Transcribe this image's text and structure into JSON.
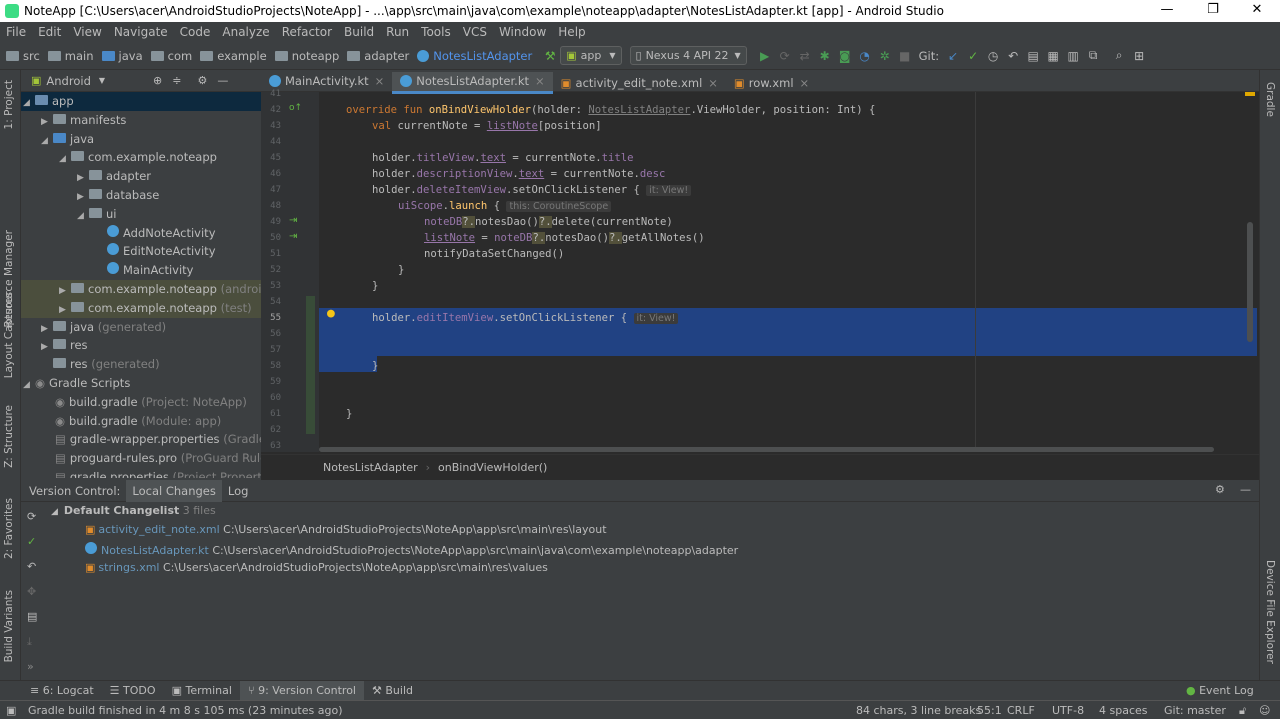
{
  "window": {
    "title": "NoteApp [C:\\Users\\acer\\AndroidStudioProjects\\NoteApp] - ...\\app\\src\\main\\java\\com\\example\\noteapp\\adapter\\NotesListAdapter.kt [app] - Android Studio",
    "min": "—",
    "max": "❐",
    "close": "✕"
  },
  "menu": [
    "File",
    "Edit",
    "View",
    "Navigate",
    "Code",
    "Analyze",
    "Refactor",
    "Build",
    "Run",
    "Tools",
    "VCS",
    "Window",
    "Help"
  ],
  "nav": {
    "crumbs": [
      "src",
      "main",
      "java",
      "com",
      "example",
      "noteapp",
      "adapter"
    ],
    "file": "NotesListAdapter",
    "config": "app",
    "device": "Nexus 4 API 22",
    "git": "Git:"
  },
  "left_strip": [
    "1: Project",
    "Resource Manager",
    "Layout Captures",
    "Z: Structure",
    "2: Favorites",
    "Build Variants"
  ],
  "right_strip": [
    "Gradle",
    "Device File Explorer"
  ],
  "project": {
    "view": "Android",
    "tree": [
      {
        "t": "app",
        "s": ""
      },
      {
        "t": "manifests",
        "s": ""
      },
      {
        "t": "java",
        "s": ""
      },
      {
        "t": "com.example.noteapp",
        "s": ""
      },
      {
        "t": "adapter",
        "s": ""
      },
      {
        "t": "database",
        "s": ""
      },
      {
        "t": "ui",
        "s": ""
      },
      {
        "t": "AddNoteActivity",
        "s": ""
      },
      {
        "t": "EditNoteActivity",
        "s": ""
      },
      {
        "t": "MainActivity",
        "s": ""
      },
      {
        "t": "com.example.noteapp",
        "s": "(androidTest)"
      },
      {
        "t": "com.example.noteapp",
        "s": "(test)"
      },
      {
        "t": "java",
        "s": "(generated)"
      },
      {
        "t": "res",
        "s": ""
      },
      {
        "t": "res",
        "s": "(generated)"
      },
      {
        "t": "Gradle Scripts",
        "s": ""
      },
      {
        "t": "build.gradle",
        "s": "(Project: NoteApp)"
      },
      {
        "t": "build.gradle",
        "s": "(Module: app)"
      },
      {
        "t": "gradle-wrapper.properties",
        "s": "(Gradle Version)"
      },
      {
        "t": "proguard-rules.pro",
        "s": "(ProGuard Rules for app)"
      },
      {
        "t": "gradle.properties",
        "s": "(Project Properties)"
      }
    ]
  },
  "editor_tabs": [
    "MainActivity.kt",
    "NotesListAdapter.kt",
    "activity_edit_note.xml",
    "row.xml"
  ],
  "line_numbers": [
    "41",
    "42",
    "43",
    "44",
    "45",
    "46",
    "47",
    "48",
    "49",
    "50",
    "51",
    "52",
    "53",
    "54",
    "55",
    "56",
    "57",
    "58",
    "59",
    "60",
    "61",
    "62",
    "63"
  ],
  "code": {
    "l42": {
      "kw": "override fun ",
      "fn": "onBindViewHolder",
      "rest": "(holder: ",
      "cls": "NotesListAdapter",
      "rest2": ".ViewHolder, position: Int) {"
    },
    "l43": {
      "kw": "val ",
      "a": "currentNote = ",
      "b": "listNote",
      "c": "[position]"
    },
    "l45": {
      "a": "holder.",
      "b": "titleView",
      "c": ".",
      "d": "text",
      "e": " = currentNote.",
      "f": "title"
    },
    "l46": {
      "a": "holder.",
      "b": "descriptionView",
      "c": ".",
      "d": "text",
      "e": " = currentNote.",
      "f": "desc"
    },
    "l47": {
      "a": "holder.",
      "b": "deleteItemView",
      "c": ".setOnClickListener {",
      "hint": "it: View!"
    },
    "l48": {
      "a": "uiScope",
      "b": ".",
      "c": "launch",
      "d": " {",
      "hint": "this: CoroutineScope"
    },
    "l49": {
      "a": "noteDB",
      "b": "?.",
      "c": "notesDao()",
      "d": "?.",
      "e": "delete(currentNote)"
    },
    "l50": {
      "a": "listNote",
      "b": " = ",
      "c": "noteDB",
      "d": "?.",
      "e": "notesDao()",
      "f": "?.",
      "g": "getAllNotes()"
    },
    "l51": "notifyDataSetChanged()",
    "l52": "}",
    "l53": "}",
    "l55": {
      "a": "holder.",
      "b": "editItemView",
      "c": ".setOnClickListener {",
      "hint": "it: View!"
    },
    "l58": "}",
    "l61": "}"
  },
  "code_breadcrumb": [
    "NotesListAdapter",
    "onBindViewHolder()"
  ],
  "vc": {
    "tabs": [
      "Version Control:",
      "Local Changes",
      "Log"
    ],
    "changelist": "Default Changelist",
    "count": "3 files",
    "files": [
      {
        "name": "activity_edit_note.xml",
        "path": "C:\\Users\\acer\\AndroidStudioProjects\\NoteApp\\app\\src\\main\\res\\layout"
      },
      {
        "name": "NotesListAdapter.kt",
        "path": "C:\\Users\\acer\\AndroidStudioProjects\\NoteApp\\app\\src\\main\\java\\com\\example\\noteapp\\adapter"
      },
      {
        "name": "strings.xml",
        "path": "C:\\Users\\acer\\AndroidStudioProjects\\NoteApp\\app\\src\\main\\res\\values"
      }
    ]
  },
  "bottom_tabs": [
    "6: Logcat",
    "TODO",
    "Terminal",
    "9: Version Control",
    "Build"
  ],
  "event_log": "Event Log",
  "status": {
    "msg": "Gradle build finished in 4 m 8 s 105 ms (23 minutes ago)",
    "chars": "84 chars, 3 line breaks",
    "pos": "55:1",
    "crlf": "CRLF",
    "enc": "UTF-8",
    "indent": "4 spaces",
    "git": "Git: master"
  },
  "colors": {
    "accent": "#4a88c7",
    "selection": "#214283",
    "bg": "#2b2b2b",
    "panel": "#3c3f41"
  }
}
